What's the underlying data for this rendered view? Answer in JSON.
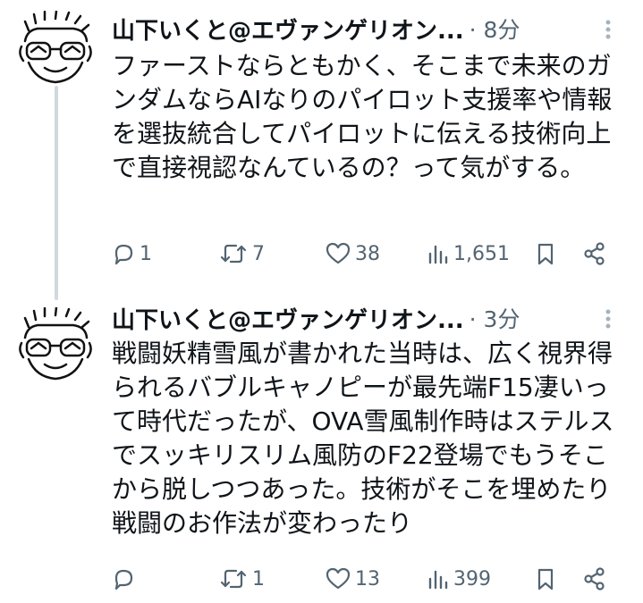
{
  "tweets": [
    {
      "author": "山下いくと@エヴァンゲリオン...",
      "time": "· 8分",
      "text": "ファーストならともかく、そこまで未来のガンダムならAIなりのパイロット支援率や情報を選抜統合してパイロットに伝える技術向上で直接視認なんているの？って気がする。",
      "replies": "1",
      "retweets": "7",
      "likes": "38",
      "views": "1,651"
    },
    {
      "author": "山下いくと@エヴァンゲリオン...",
      "time": "· 3分",
      "text": "戦闘妖精雪風が書かれた当時は、広く視界得られるバブルキャノピーが最先端F15凄いって時代だったが、OVA雪風制作時はステルスでスッキリスリム風防のF22登場でもうそこから脱しつつあった。技術がそこを埋めたり戦闘のお作法が変わったり",
      "replies": "",
      "retweets": "1",
      "likes": "13",
      "views": "399"
    }
  ],
  "icons": [
    "reply-icon",
    "retweet-icon",
    "like-icon",
    "views-icon",
    "bookmark-icon",
    "share-icon",
    "more-icon"
  ],
  "colors": {
    "text": "#0f1419",
    "muted": "#536471",
    "thread_line": "#cfd9de",
    "background": "#ffffff"
  }
}
